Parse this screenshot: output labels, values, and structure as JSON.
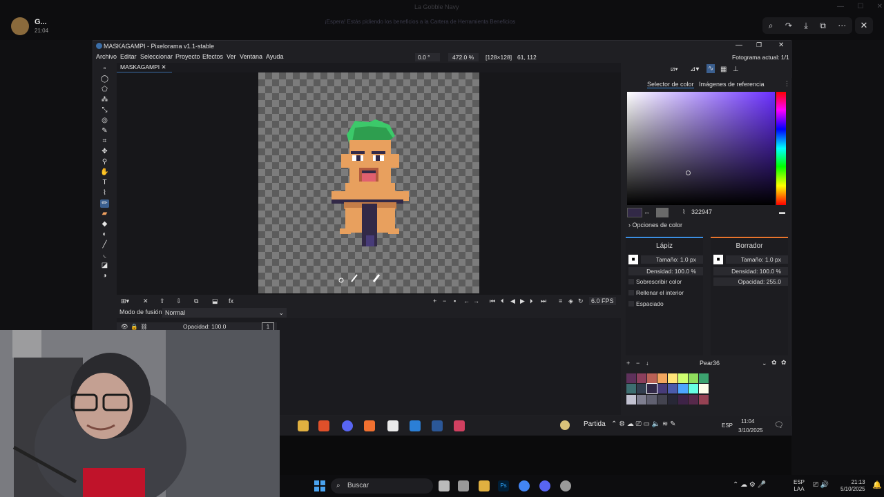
{
  "viewer": {
    "user_name": "G...",
    "user_time": "21:04",
    "window_title": "La Gobble Navy",
    "banner_text": "¡Espera! Estás pidiendo los beneficios a la Cartera de Herramienta Beneficios",
    "icons": [
      "zoom-icon",
      "share-icon",
      "download-icon",
      "open-external-icon",
      "more-icon",
      "close-icon"
    ]
  },
  "app": {
    "title": "MASKAGAMPI - Pixelorama v1.1-stable",
    "menu": [
      "Archivo",
      "Editar",
      "Seleccionar",
      "Proyecto",
      "Efectos",
      "Ver",
      "Ventana",
      "Ayuda"
    ],
    "rotation": "0.0 °",
    "zoom": "472.0 %",
    "canvas_size": "[128×128]",
    "cursor_pos": "61, 112",
    "frame_label": "Fotograma actual: 1/1",
    "tab": "MASKAGAMPI"
  },
  "animation": {
    "fps": "6.0 FPS",
    "blend_label": "Modo de fusión:",
    "blend_value": "Normal",
    "layer_opacity": "Opacidad: 100.0",
    "frame_number": "1"
  },
  "color_panel": {
    "tab_selector": "Selector de color",
    "tab_reference": "Imágenes de referencia",
    "hex": "322947",
    "options_label": "Opciones de color",
    "current_color": "#322947"
  },
  "left_tool": {
    "title": "Lápiz",
    "size": "Tamaño: 1.0 px",
    "density": "Densidad: 100.0 %",
    "overwrite": "Sobrescribir color",
    "fill_inside": "Rellenar el interior",
    "spacing": "Espaciado"
  },
  "right_tool": {
    "title": "Borrador",
    "size": "Tamaño: 1.0 px",
    "density": "Densidad: 100.0 %",
    "opacity": "Opacidad: 255.0"
  },
  "palette": {
    "name": "Pear36",
    "colors": [
      "#5e315b",
      "#8c3f5d",
      "#ba6156",
      "#f2a65e",
      "#ffe478",
      "#cfff70",
      "#8fde5d",
      "#3ca370",
      "#3d6e70",
      "#323e4f",
      "#322947",
      "#473b78",
      "#4b5bab",
      "#4da6ff",
      "#66ffe3",
      "#ffffeb",
      "#c2c2d1",
      "#7e7e8f",
      "#606070",
      "#43434f",
      "#272736",
      "#3e2347",
      "#57294b",
      "#964253"
    ]
  },
  "inner_taskbar": {
    "game_label": "Partida",
    "lang": "ESP",
    "time": "11:04",
    "date": "3/10/2025"
  },
  "outer_taskbar": {
    "search": "Buscar",
    "lang_line1": "ESP",
    "lang_line2": "LAA",
    "time": "21:13",
    "date": "5/10/2025"
  }
}
